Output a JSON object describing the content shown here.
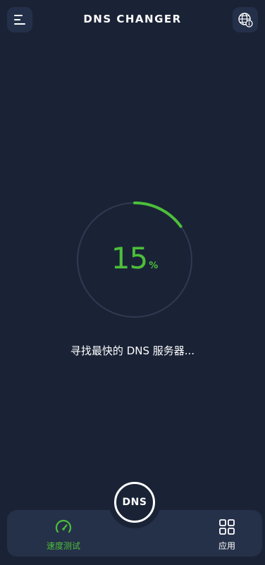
{
  "header": {
    "title": "DNS CHANGER",
    "menu_icon": "menu-icon",
    "globe_icon": "globe-info-icon"
  },
  "progress": {
    "value": 15,
    "number_text": "15",
    "unit": "%",
    "status": "寻找最快的 DNS 服务器..."
  },
  "center_button": {
    "label": "DNS"
  },
  "bottom_nav": {
    "items": [
      {
        "label": "速度测试",
        "icon": "speedometer-icon",
        "active": true
      },
      {
        "label": "应用",
        "icon": "grid-icon",
        "active": false
      }
    ]
  },
  "colors": {
    "background": "#1a2336",
    "surface": "#253049",
    "accent": "#4cbf3a",
    "ring_track": "#2f3a52"
  }
}
